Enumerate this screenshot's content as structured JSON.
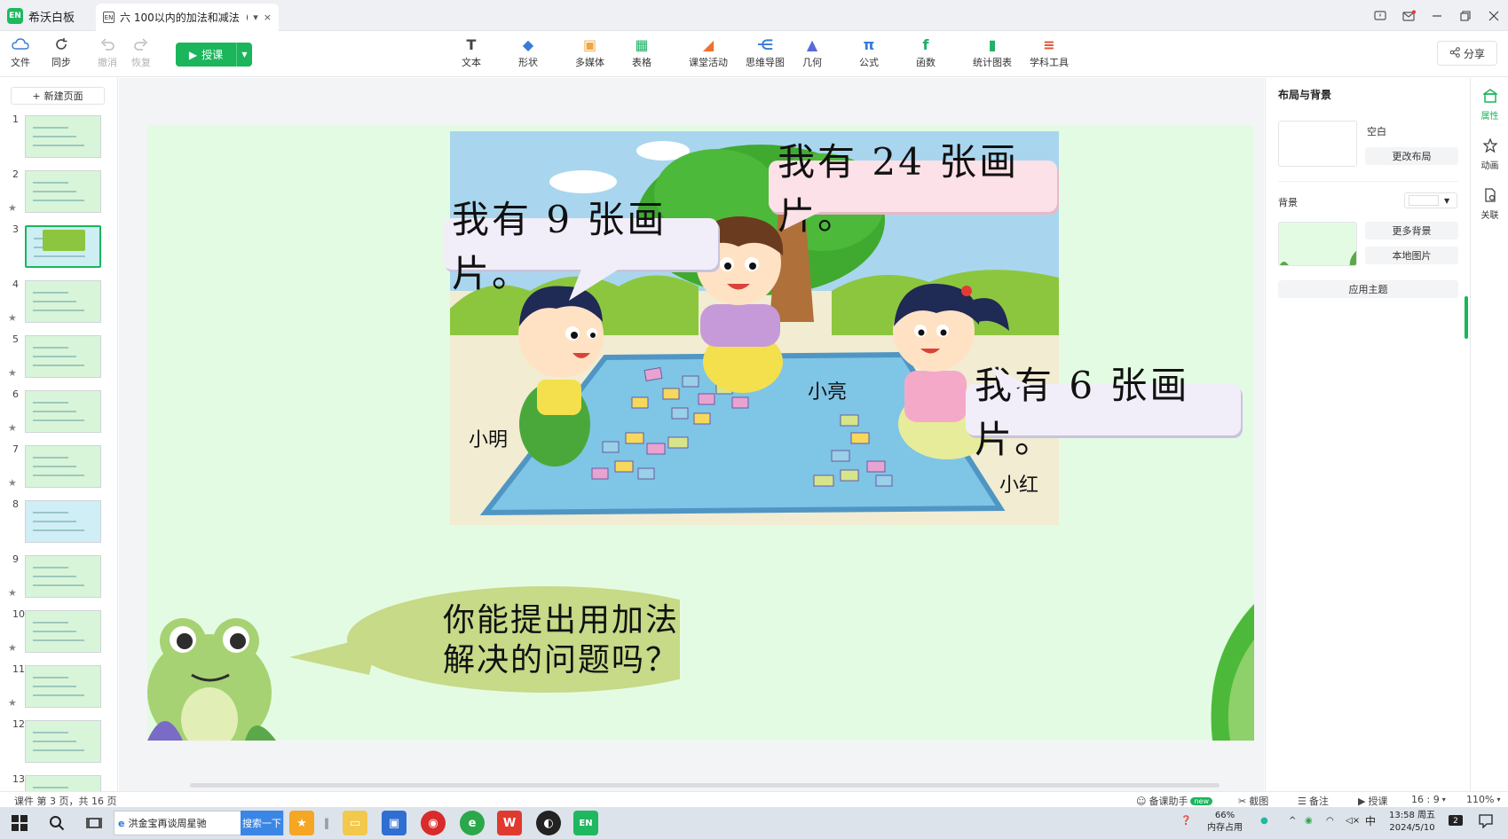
{
  "app": {
    "name": "希沃白板",
    "logo": "EN"
  },
  "tab": {
    "title": "六 100以内的加法和减法（...",
    "close": "×",
    "dropdown": "▾"
  },
  "toolbar": {
    "file": "文件",
    "sync": "同步",
    "undo": "撤消",
    "redo": "恢复",
    "teach": "授课",
    "tools": [
      {
        "label": "文本",
        "icon": "T",
        "color": "#444444"
      },
      {
        "label": "形状",
        "icon": "◆",
        "color": "#3a7bd5"
      },
      {
        "label": "多媒体",
        "icon": "▣",
        "color": "#f0a640"
      },
      {
        "label": "表格",
        "icon": "▦",
        "color": "#20b066"
      },
      {
        "label": "课堂活动",
        "icon": "◢",
        "color": "#f07030"
      },
      {
        "label": "思维导图",
        "icon": "⋲",
        "color": "#3a7bd5"
      },
      {
        "label": "几何",
        "icon": "▲",
        "color": "#5b6ad5"
      },
      {
        "label": "公式",
        "icon": "π",
        "color": "#3a7bd5"
      },
      {
        "label": "函数",
        "icon": "f",
        "color": "#20b066"
      },
      {
        "label": "统计图表",
        "icon": "▮",
        "color": "#20b066"
      },
      {
        "label": "学科工具",
        "icon": "≡",
        "color": "#e05030"
      }
    ],
    "share": "分享"
  },
  "slides": {
    "new_page": "新建页面",
    "items": [
      {
        "num": "1",
        "star": ""
      },
      {
        "num": "2",
        "star": "★"
      },
      {
        "num": "3",
        "star": ""
      },
      {
        "num": "4",
        "star": "★"
      },
      {
        "num": "5",
        "star": "★"
      },
      {
        "num": "6",
        "star": "★"
      },
      {
        "num": "7",
        "star": "★"
      },
      {
        "num": "8",
        "star": ""
      },
      {
        "num": "9",
        "star": "★"
      },
      {
        "num": "10",
        "star": "★"
      },
      {
        "num": "11",
        "star": "★"
      },
      {
        "num": "12",
        "star": ""
      },
      {
        "num": "13",
        "star": ""
      }
    ],
    "active_index": 2
  },
  "slide": {
    "bubble_9": "我有 9 张画片。",
    "bubble_24": "我有 24 张画片。",
    "bubble_6": "我有 6 张画片。",
    "name_ming": "小明",
    "name_liang": "小亮",
    "name_hong": "小红",
    "question_line1": "你能提出用加法",
    "question_line2": "解决的问题吗？"
  },
  "right_panel": {
    "title": "布局与背景",
    "layout_name": "空白",
    "change_layout": "更改布局",
    "background": "背景",
    "more_bg": "更多背景",
    "local_image": "本地图片",
    "apply_theme": "应用主题"
  },
  "side_strip": {
    "properties": "属性",
    "animation": "动画",
    "link": "关联"
  },
  "status": {
    "page_info": "课件 第 3 页，共 16 页",
    "assistant": "备课助手",
    "new_badge": "new",
    "screenshot": "截图",
    "notes": "备注",
    "teach": "授课",
    "ratio": "16 : 9",
    "zoom": "110%"
  },
  "taskbar": {
    "search_text": "洪金宝再谈周星驰",
    "search_btn": "搜索一下",
    "mem_percent": "66%",
    "mem_label": "内存占用",
    "ime": "中",
    "time": "13:58 周五",
    "date": "2024/5/10",
    "notif_count": "2"
  },
  "colors": {
    "accent": "#1bb55c",
    "slide_bg": "#e4fbe3",
    "bubble_purple": "#f1eef9",
    "bubble_pink": "#fce1e8",
    "question_bubble": "#c6da87"
  }
}
